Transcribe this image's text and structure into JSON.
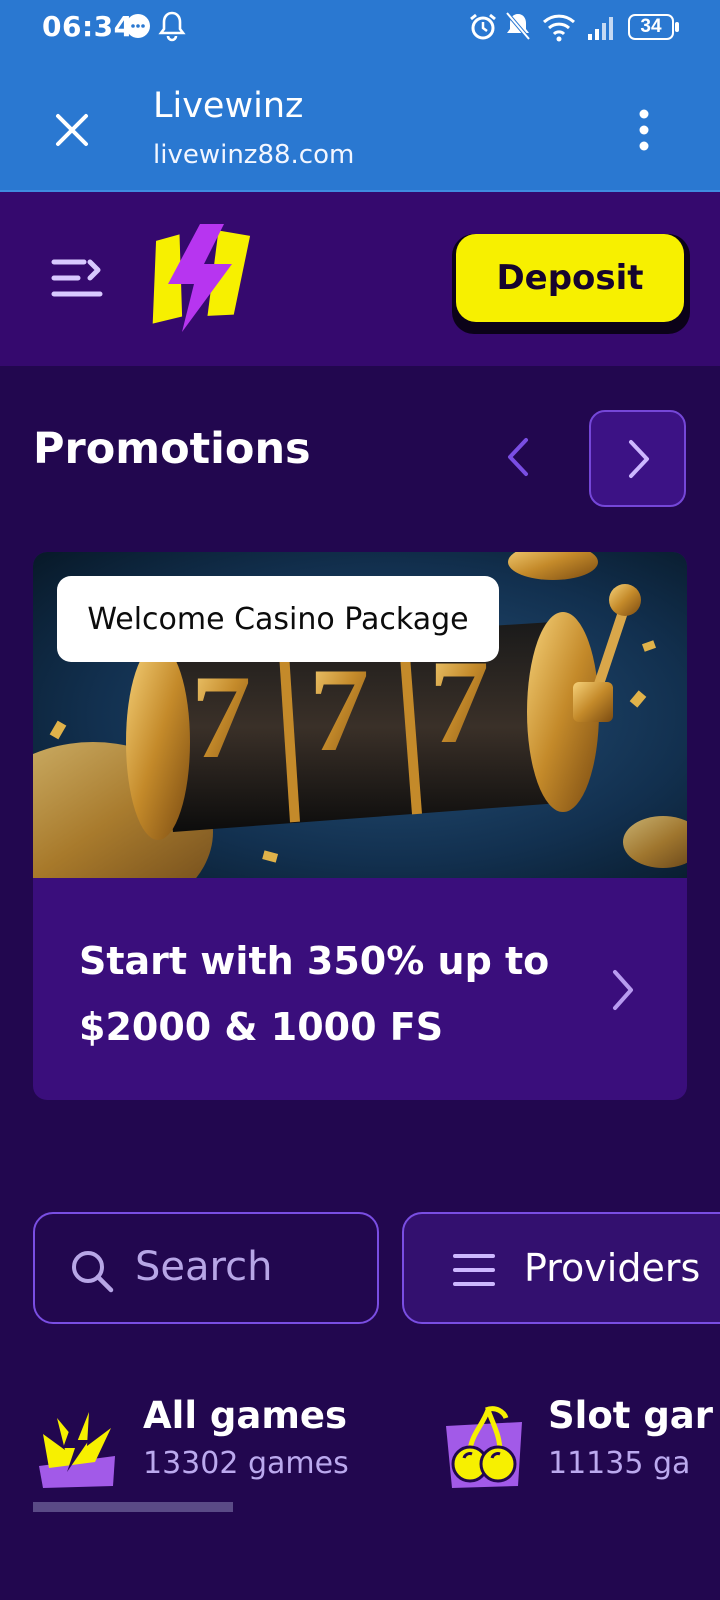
{
  "status_bar": {
    "time": "06:34",
    "battery": "34"
  },
  "browser": {
    "title": "Livewinz",
    "url": "livewinz88.com"
  },
  "header": {
    "deposit_label": "Deposit",
    "logo_colors": {
      "primary": "#f7f000",
      "bolt": "#b735f0"
    }
  },
  "promotions": {
    "title": "Promotions",
    "card": {
      "label": "Welcome Casino Package",
      "text": "Start with 350% up to $2000 & 1000 FS"
    }
  },
  "search": {
    "placeholder": "Search"
  },
  "providers": {
    "label": "Providers"
  },
  "categories": [
    {
      "name": "All games",
      "count": "13302 games",
      "icon": "lightning-burst-icon"
    },
    {
      "name": "Slot gar",
      "count": "11135 ga",
      "icon": "cherry-icon"
    }
  ],
  "colors": {
    "browser_bar": "#2a78d1",
    "header_bg": "#35096e",
    "page_bg": "#22074f",
    "accent": "#f7f000",
    "border_accent": "#7a4ee3"
  }
}
